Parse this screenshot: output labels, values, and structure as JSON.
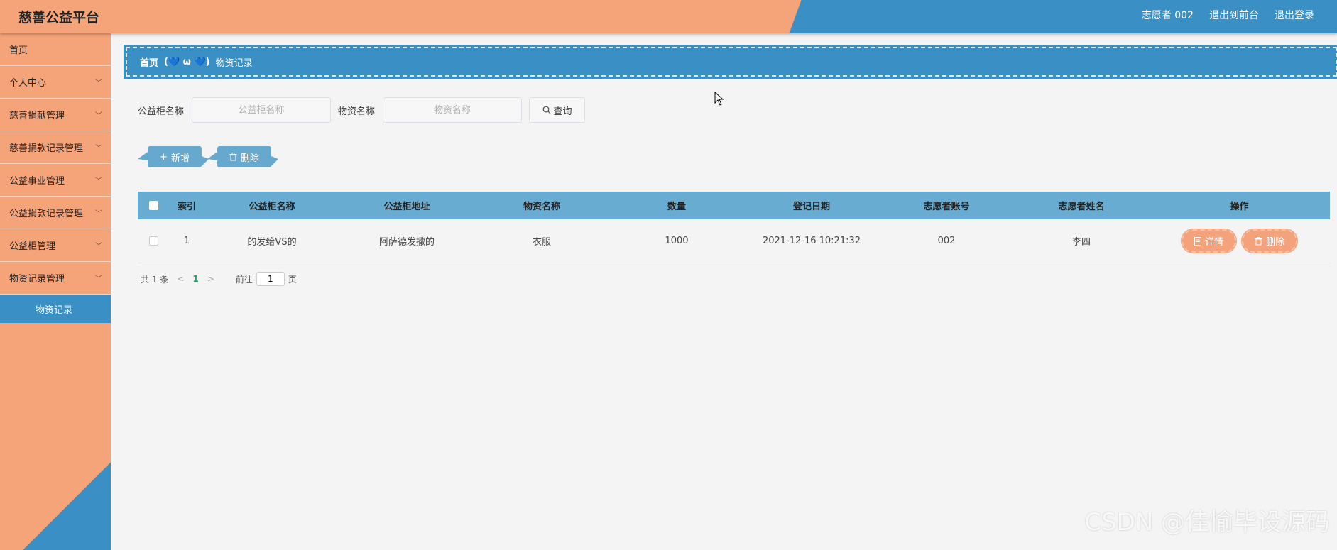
{
  "header": {
    "title": "慈善公益平台",
    "user": "志愿者 002",
    "exit_front": "退出到前台",
    "logout": "退出登录"
  },
  "sidebar": {
    "items": [
      {
        "label": "首页",
        "has_arrow": false
      },
      {
        "label": "个人中心",
        "has_arrow": true
      },
      {
        "label": "慈善捐献管理",
        "has_arrow": true
      },
      {
        "label": "慈善捐款记录管理",
        "has_arrow": true
      },
      {
        "label": "公益事业管理",
        "has_arrow": true
      },
      {
        "label": "公益捐款记录管理",
        "has_arrow": true
      },
      {
        "label": "公益柜管理",
        "has_arrow": true
      },
      {
        "label": "物资记录管理",
        "has_arrow": true
      }
    ],
    "active_sub": "物资记录"
  },
  "breadcrumb": {
    "home": "首页",
    "separator": "(💙 ω 💙)",
    "current": "物资记录"
  },
  "search": {
    "cabinet_label": "公益柜名称",
    "cabinet_placeholder": "公益柜名称",
    "material_label": "物资名称",
    "material_placeholder": "物资名称",
    "query_label": "查询"
  },
  "actions": {
    "add_label": "新增",
    "delete_label": "删除"
  },
  "table": {
    "headers": [
      "索引",
      "公益柜名称",
      "公益柜地址",
      "物资名称",
      "数量",
      "登记日期",
      "志愿者账号",
      "志愿者姓名",
      "操作"
    ],
    "rows": [
      {
        "index": "1",
        "cabinet": "的发给VS的",
        "address": "阿萨德发撒的",
        "material": "衣服",
        "quantity": "1000",
        "date": "2021-12-16 10:21:32",
        "account": "002",
        "name": "李四",
        "detail_label": "详情",
        "delete_label": "删除"
      }
    ]
  },
  "pager": {
    "total": "共 1 条",
    "current_page": "1",
    "goto_label": "前往",
    "goto_value": "1",
    "page_suffix": "页"
  },
  "watermark": "CSDN @佳愉毕设源码",
  "colors": {
    "accent_orange": "#f5a47a",
    "accent_blue": "#3a8fc4",
    "table_header": "#69acd2"
  }
}
